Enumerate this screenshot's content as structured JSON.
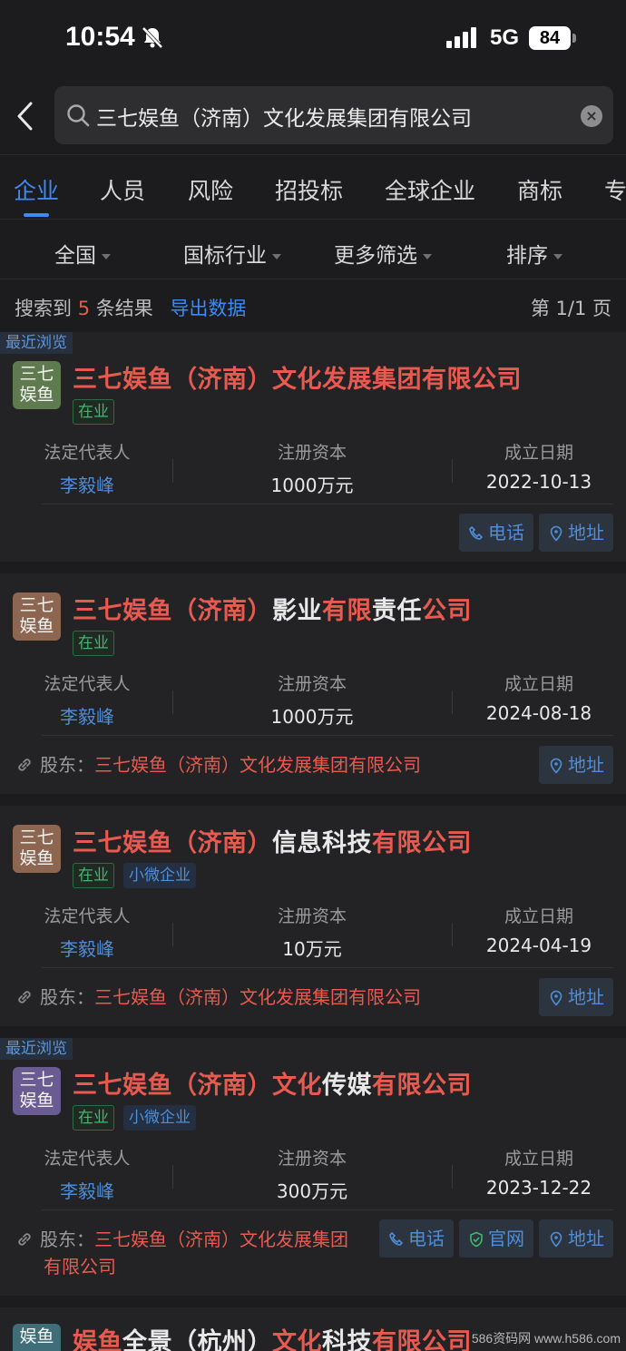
{
  "status_bar": {
    "time": "10:54",
    "network": "5G",
    "battery": "84"
  },
  "search": {
    "query": "三七娱鱼（济南）文化发展集团有限公司"
  },
  "tabs": [
    "企业",
    "人员",
    "风险",
    "招投标",
    "全球企业",
    "商标",
    "专"
  ],
  "filters": [
    "全国",
    "国标行业",
    "更多筛选",
    "排序"
  ],
  "results": {
    "prefix": "搜索到",
    "count": "5",
    "suffix": "条结果",
    "export": "导出数据",
    "page": "第 1/1 页"
  },
  "labels": {
    "legal_rep": "法定代表人",
    "capital": "注册资本",
    "founded": "成立日期",
    "shareholder": "股东：",
    "recent": "最近浏览"
  },
  "companies": [
    {
      "logo_line1": "三七",
      "logo_line2": "娱鱼",
      "logo_color": "#5e7a4e",
      "name_parts": [
        {
          "t": "三七娱鱼（济南）文化发展集团有限公司",
          "hl": true
        }
      ],
      "tags": [
        "在业"
      ],
      "legal_rep": "李毅峰",
      "capital": "1000万元",
      "founded": "2022-10-13",
      "buttons": [
        "电话",
        "地址"
      ]
    },
    {
      "logo_line1": "三七",
      "logo_line2": "娱鱼",
      "logo_color": "#8d6651",
      "name_parts": [
        {
          "t": "三七娱鱼（济南）",
          "hl": true
        },
        {
          "t": "影业",
          "hl": false
        },
        {
          "t": "有限",
          "hl": true
        },
        {
          "t": "责任",
          "hl": false
        },
        {
          "t": "公司",
          "hl": true
        }
      ],
      "tags": [
        "在业"
      ],
      "legal_rep": "李毅峰",
      "capital": "1000万元",
      "founded": "2024-08-18",
      "shareholder": "三七娱鱼（济南）文化发展集团有限公司",
      "buttons": [
        "地址"
      ]
    },
    {
      "logo_line1": "三七",
      "logo_line2": "娱鱼",
      "logo_color": "#8d6651",
      "name_parts": [
        {
          "t": "三七娱鱼（济南）",
          "hl": true
        },
        {
          "t": "信息科技",
          "hl": false
        },
        {
          "t": "有限公司",
          "hl": true
        }
      ],
      "tags": [
        "在业",
        "小微企业"
      ],
      "legal_rep": "李毅峰",
      "capital": "10万元",
      "founded": "2024-04-19",
      "shareholder": "三七娱鱼（济南）文化发展集团有限公司",
      "buttons": [
        "地址"
      ]
    },
    {
      "logo_line1": "三七",
      "logo_line2": "娱鱼",
      "logo_color": "#6a5c92",
      "name_parts": [
        {
          "t": "三七娱鱼（济南）文化",
          "hl": true
        },
        {
          "t": "传媒",
          "hl": false
        },
        {
          "t": "有限公司",
          "hl": true
        }
      ],
      "tags": [
        "在业",
        "小微企业"
      ],
      "legal_rep": "李毅峰",
      "capital": "300万元",
      "founded": "2023-12-22",
      "shareholder_line1": "三七娱鱼（济南）文化发展集团",
      "shareholder_line2": "有限公司",
      "buttons": [
        "电话",
        "官网",
        "地址"
      ]
    },
    {
      "logo_line1": "娱鱼",
      "logo_color": "#3f6e78",
      "name_parts": [
        {
          "t": "娱鱼",
          "hl": true
        },
        {
          "t": "全景（杭州）",
          "hl": false
        },
        {
          "t": "文化",
          "hl": true
        },
        {
          "t": "科技",
          "hl": false
        },
        {
          "t": "有限公司",
          "hl": true
        }
      ]
    }
  ],
  "watermark": "586资码网 www.h586.com"
}
